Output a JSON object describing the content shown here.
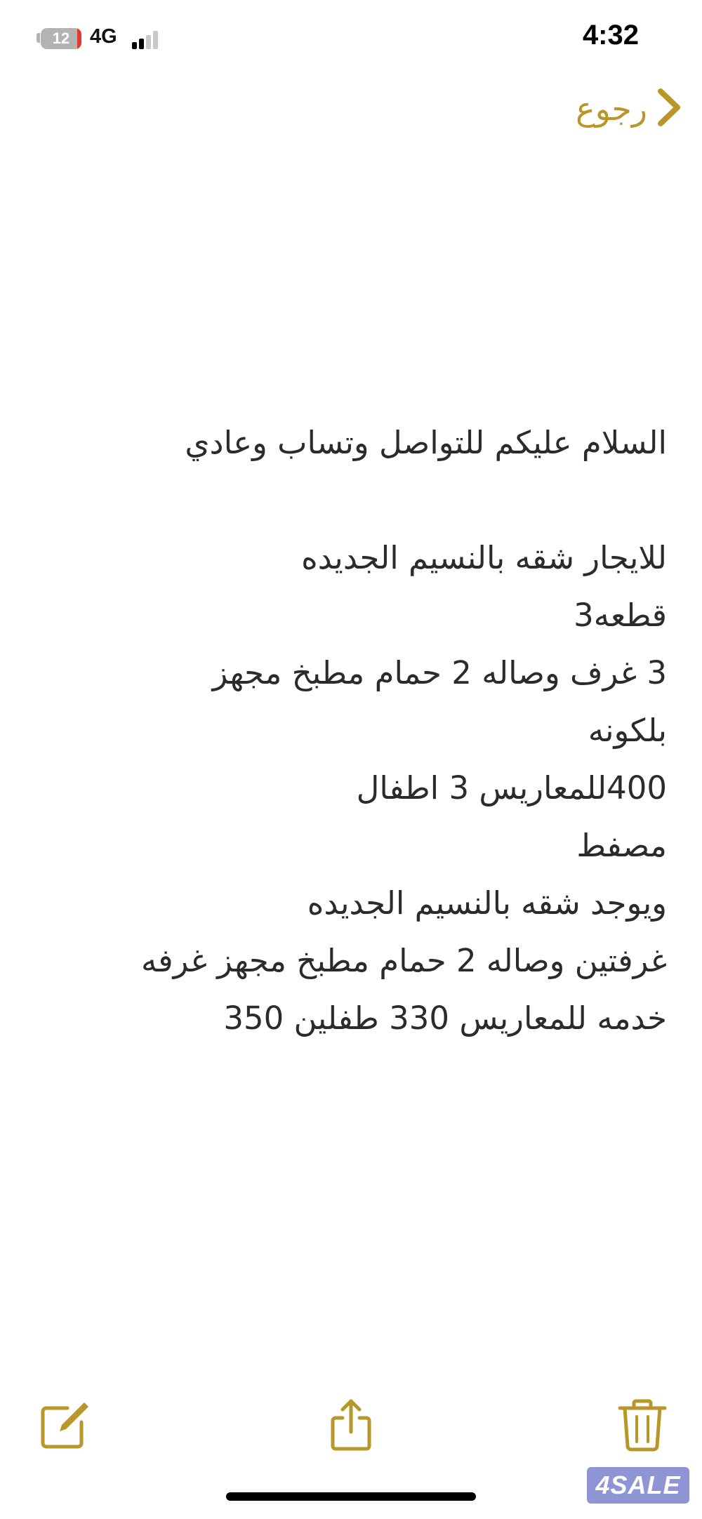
{
  "status_bar": {
    "battery_level": "12",
    "network": "4G",
    "time": "4:32",
    "signal_bars_active": 2,
    "signal_bars_total": 4
  },
  "nav": {
    "back_label": "رجوع"
  },
  "note": {
    "lines": [
      "السلام عليكم للتواصل وتساب وعادي",
      "",
      "للايجار شقه بالنسيم الجديده",
      "قطعه3",
      "3 غرف وصاله 2 حمام مطبخ مجهز",
      "بلكونه",
      "400للمعاريس 3 اطفال",
      "مصفط",
      "ويوجد شقه بالنسيم الجديده",
      "غرفتين وصاله 2 حمام مطبخ مجهز غرفه",
      "خدمه للمعاريس 330 طفلين 350"
    ]
  },
  "toolbar": {
    "compose_icon": "compose-icon",
    "share_icon": "share-icon",
    "trash_icon": "trash-icon"
  },
  "watermark": {
    "text": "4SALE"
  },
  "colors": {
    "accent": "#b8962a",
    "text": "#2b2b2b",
    "background": "#ffffff"
  }
}
